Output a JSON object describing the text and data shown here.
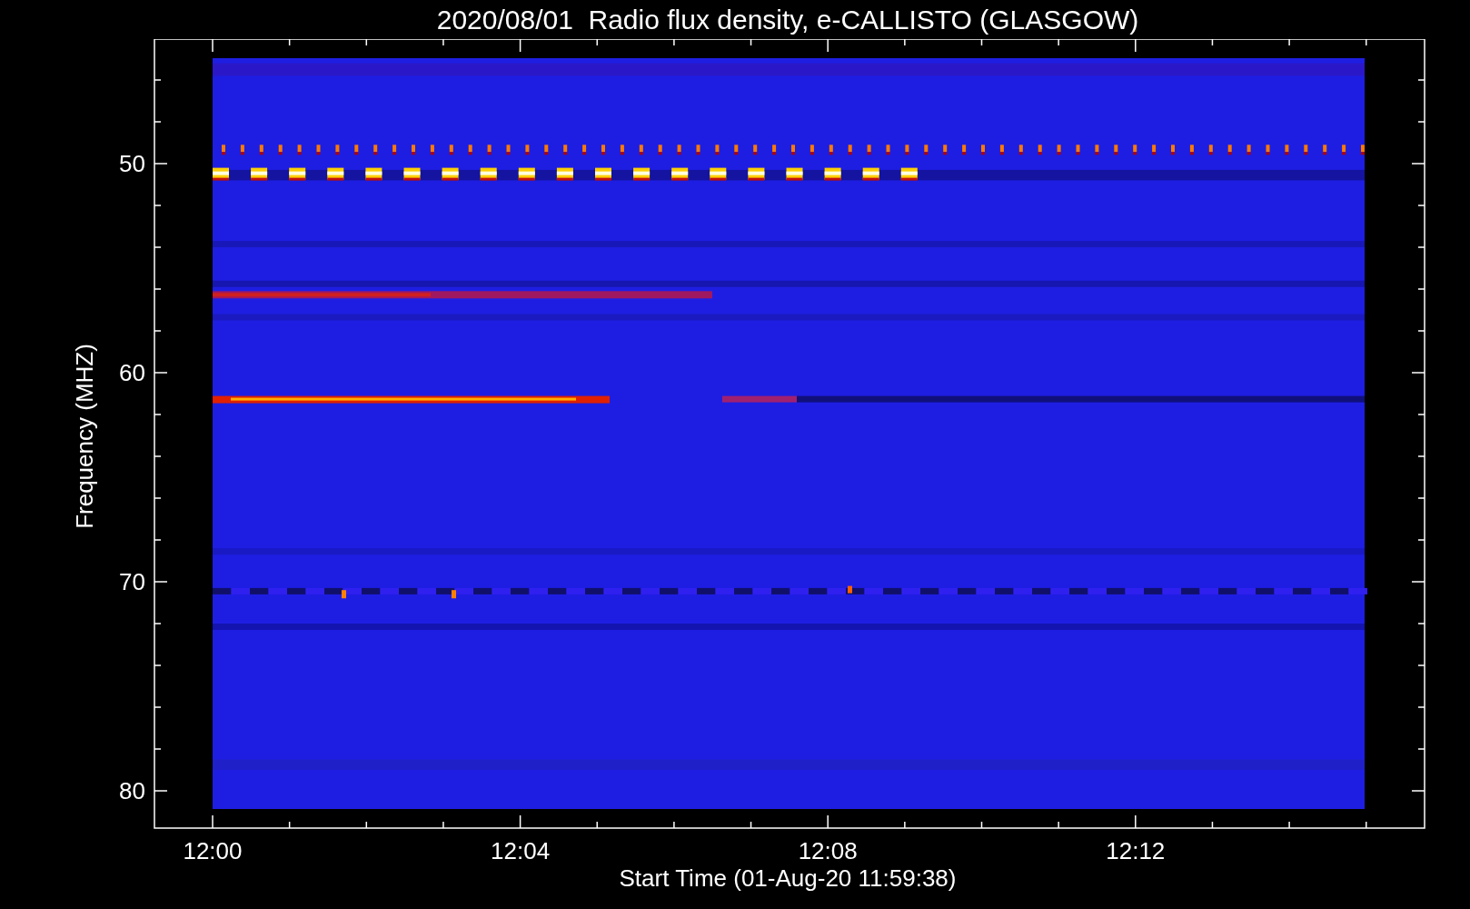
{
  "title": "2020/08/01  Radio flux density, e-CALLISTO (GLASGOW)",
  "y_axis": {
    "label": "Frequency (MHZ)",
    "ticks": [
      "50",
      "60",
      "70",
      "80"
    ]
  },
  "x_axis": {
    "label": "Start Time (01-Aug-20 11:59:38)",
    "ticks": [
      "12:00",
      "12:04",
      "12:08",
      "12:12"
    ]
  }
}
